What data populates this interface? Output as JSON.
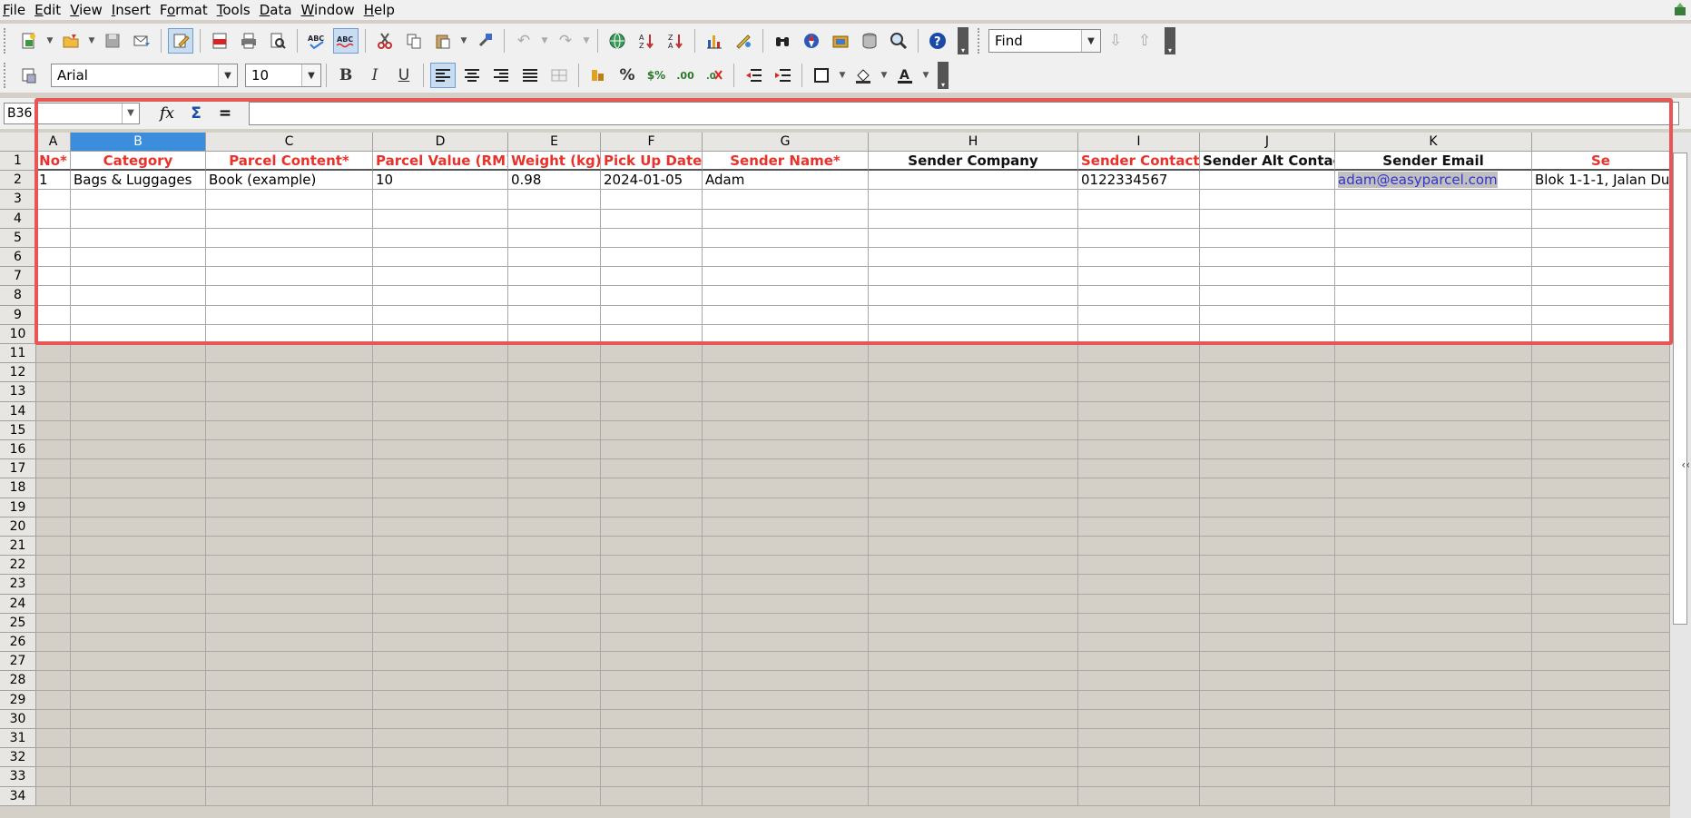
{
  "menu": [
    "File",
    "Edit",
    "View",
    "Insert",
    "Format",
    "Tools",
    "Data",
    "Window",
    "Help"
  ],
  "menu_mnemonics": [
    "F",
    "E",
    "V",
    "I",
    "o",
    "T",
    "D",
    "W",
    "H"
  ],
  "find": {
    "placeholder": "Find"
  },
  "font": {
    "name": "Arial",
    "size": "10"
  },
  "name_box": "B36",
  "columns": [
    "A",
    "B",
    "C",
    "D",
    "E",
    "F",
    "G",
    "H",
    "I",
    "J",
    "K",
    ""
  ],
  "selected_column": "B",
  "header_row": [
    {
      "text": "No*",
      "color": "red"
    },
    {
      "text": "Category",
      "color": "red"
    },
    {
      "text": "Parcel Content*",
      "color": "red"
    },
    {
      "text": "Parcel Value (RM)",
      "color": "red"
    },
    {
      "text": "Weight (kg)*",
      "color": "red"
    },
    {
      "text": "Pick Up Date*",
      "color": "red"
    },
    {
      "text": "Sender Name*",
      "color": "red"
    },
    {
      "text": "Sender Company",
      "color": "black"
    },
    {
      "text": "Sender Contact*",
      "color": "red"
    },
    {
      "text": "Sender Alt Contact",
      "color": "black"
    },
    {
      "text": "Sender Email",
      "color": "black"
    },
    {
      "text": "Se",
      "color": "red"
    }
  ],
  "data_row": [
    "1",
    "Bags & Luggages",
    "Book (example)",
    "10",
    "0.98",
    "2024-01-05",
    "Adam",
    "",
    "0122334567",
    "",
    "adam@easyparcel.com",
    "Blok 1-1-1, Jalan Du"
  ],
  "row_numbers": [
    "1",
    "2",
    "3",
    "4",
    "5",
    "6",
    "7",
    "8",
    "9",
    "10",
    "11",
    "12",
    "13",
    "14",
    "15",
    "16",
    "17",
    "18",
    "19",
    "20",
    "21",
    "22",
    "23",
    "24",
    "25",
    "26",
    "27",
    "28",
    "29",
    "30",
    "31",
    "32",
    "33",
    "34"
  ],
  "colors": {
    "required_header": "#e8322b",
    "selection_blue": "#3c8ddb",
    "highlight_border": "#e85555"
  }
}
